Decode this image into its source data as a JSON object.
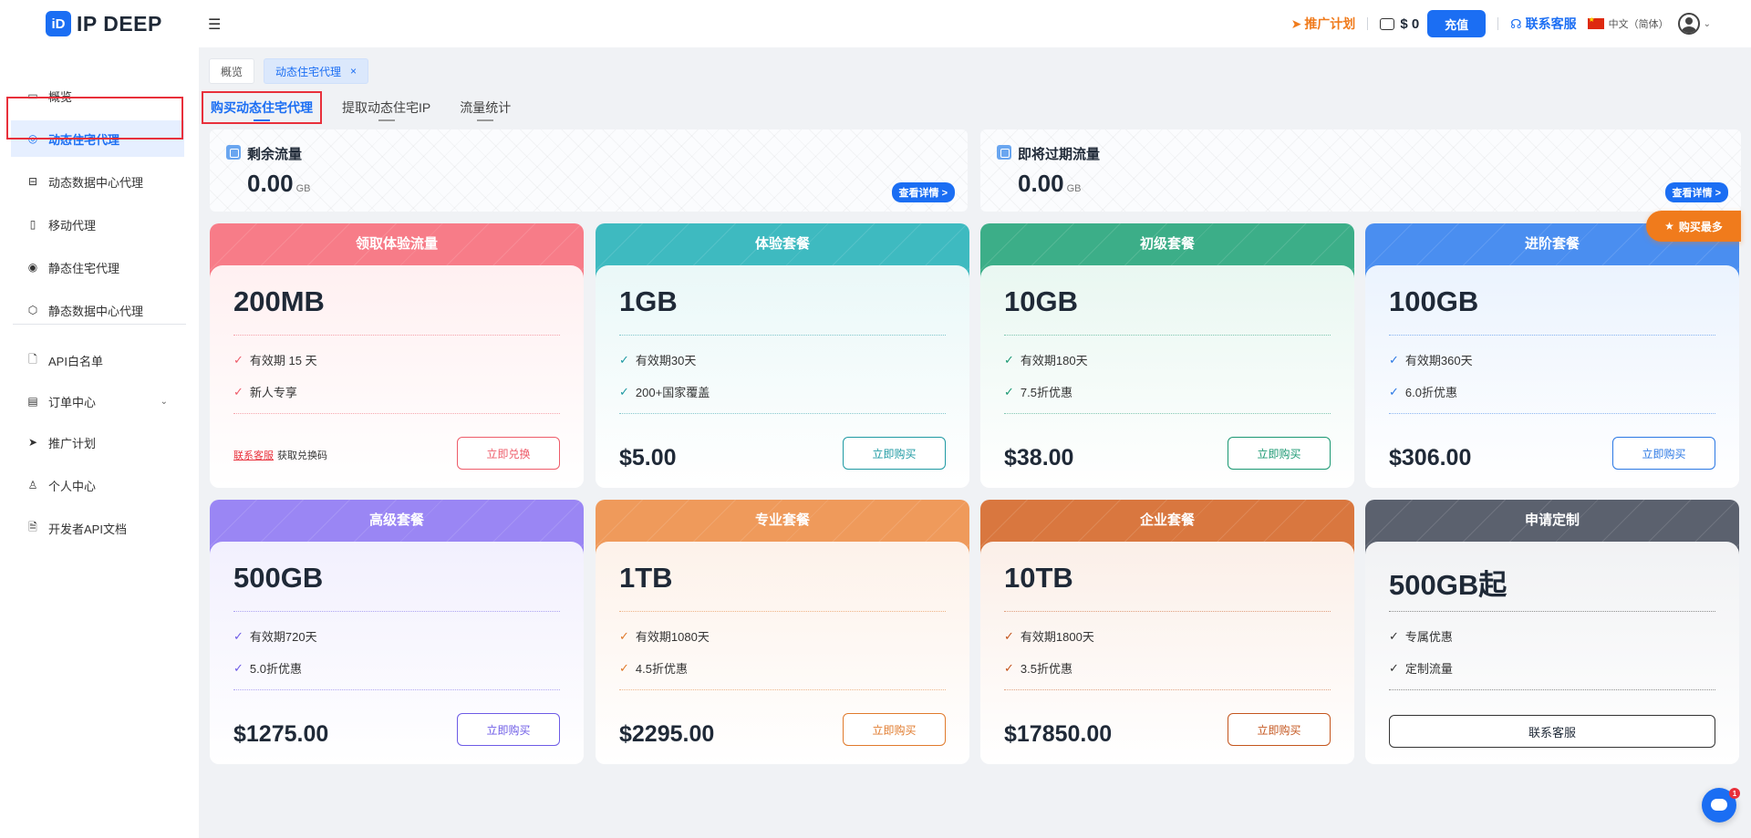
{
  "header": {
    "logo_mark": "iD",
    "logo_text": "IP DEEP",
    "promo_label": "推广计划",
    "balance": "$ 0",
    "topup_label": "充值",
    "support_label": "联系客服",
    "language": "中文（简体）"
  },
  "sidebar": {
    "items": [
      {
        "label": "概览",
        "icon": "overview-icon"
      },
      {
        "label": "动态住宅代理",
        "icon": "location-pin-icon",
        "active": true
      },
      {
        "label": "动态数据中心代理",
        "icon": "datacenter-icon"
      },
      {
        "label": "移动代理",
        "icon": "mobile-icon"
      },
      {
        "label": "静态住宅代理",
        "icon": "location-pin-icon"
      },
      {
        "label": "静态数据中心代理",
        "icon": "chart-icon"
      },
      {
        "label": "API白名单",
        "icon": "document-key-icon"
      },
      {
        "label": "订单中心",
        "icon": "order-icon"
      },
      {
        "label": "推广计划",
        "icon": "send-icon"
      },
      {
        "label": "个人中心",
        "icon": "user-icon"
      },
      {
        "label": "开发者API文档",
        "icon": "document-icon"
      }
    ]
  },
  "page_tabs": [
    {
      "label": "概览"
    },
    {
      "label": "动态住宅代理",
      "close": "×"
    }
  ],
  "subtabs": [
    "购买动态住宅代理",
    "提取动态住宅IP",
    "流量统计"
  ],
  "stats": [
    {
      "title": "剩余流量",
      "value": "0.00",
      "unit": "GB",
      "button": "查看详情 >"
    },
    {
      "title": "即将过期流量",
      "value": "0.00",
      "unit": "GB",
      "button": "查看详情 >"
    }
  ],
  "badge_most": "购买最多",
  "cards": [
    {
      "title": "领取体验流量",
      "amount": "200MB",
      "features": [
        "有效期 15 天",
        "新人专享"
      ],
      "link": "联系客服",
      "link_suffix": "获取兑换码",
      "button": "立即兑换",
      "accent": "#ee5c6a",
      "head": "#f77c88",
      "tint": "#fff0f1"
    },
    {
      "title": "体验套餐",
      "amount": "1GB",
      "features": [
        "有效期30天",
        "200+国家覆盖"
      ],
      "price": "$5.00",
      "button": "立即购买",
      "accent": "#1f9aa3",
      "head": "#3ebac0",
      "tint": "#eaf8f8"
    },
    {
      "title": "初级套餐",
      "amount": "10GB",
      "features": [
        "有效期180天",
        "7.5折优惠"
      ],
      "price": "$38.00",
      "button": "立即购买",
      "accent": "#1a9872",
      "head": "#3cae88",
      "tint": "#e9f7f1"
    },
    {
      "title": "进阶套餐",
      "amount": "100GB",
      "features": [
        "有效期360天",
        "6.0折优惠"
      ],
      "price": "$306.00",
      "button": "立即购买",
      "accent": "#2b78e4",
      "head": "#4a8ef0",
      "tint": "#ebf3fe"
    },
    {
      "title": "高级套餐",
      "amount": "500GB",
      "features": [
        "有效期720天",
        "5.0折优惠"
      ],
      "price": "$1275.00",
      "button": "立即购买",
      "accent": "#6d5be6",
      "head": "#9a86f4",
      "tint": "#f2f0fe"
    },
    {
      "title": "专业套餐",
      "amount": "1TB",
      "features": [
        "有效期1080天",
        "4.5折优惠"
      ],
      "price": "$2295.00",
      "button": "立即购买",
      "accent": "#e07a2c",
      "head": "#ef9a5b",
      "tint": "#fdf2ea"
    },
    {
      "title": "企业套餐",
      "amount": "10TB",
      "features": [
        "有效期1800天",
        "3.5折优惠"
      ],
      "price": "$17850.00",
      "button": "立即购买",
      "accent": "#c4551d",
      "head": "#d9773f",
      "tint": "#fbefe8"
    },
    {
      "title": "申请定制",
      "amount": "500GB起",
      "features": [
        "专属优惠",
        "定制流量"
      ],
      "button": "联系客服",
      "accent": "#333333",
      "head": "#5b616e",
      "tint": "#f1f2f4"
    }
  ],
  "chat_unread": "1"
}
